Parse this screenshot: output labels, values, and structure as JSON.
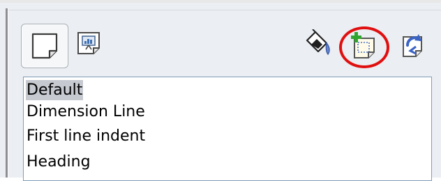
{
  "toolbar": {
    "left_buttons": [
      {
        "name": "paragraph-styles",
        "icon": "paragraph-styles-icon",
        "selected": true
      },
      {
        "name": "presentation-styles",
        "icon": "presentation-styles-icon",
        "selected": false
      }
    ],
    "right_buttons": [
      {
        "name": "fill-format-mode",
        "icon": "paint-bucket-icon"
      },
      {
        "name": "new-style-from-selection",
        "icon": "new-style-icon",
        "circled": true
      },
      {
        "name": "update-style",
        "icon": "update-style-icon"
      }
    ]
  },
  "style_list": {
    "items": [
      "Default",
      "Dimension Line",
      "First line indent",
      "Heading"
    ],
    "selected_index": 0
  },
  "colors": {
    "highlight": "#c6c9d0",
    "annotation_ring": "#e01010",
    "list_border": "#7f9db9"
  }
}
